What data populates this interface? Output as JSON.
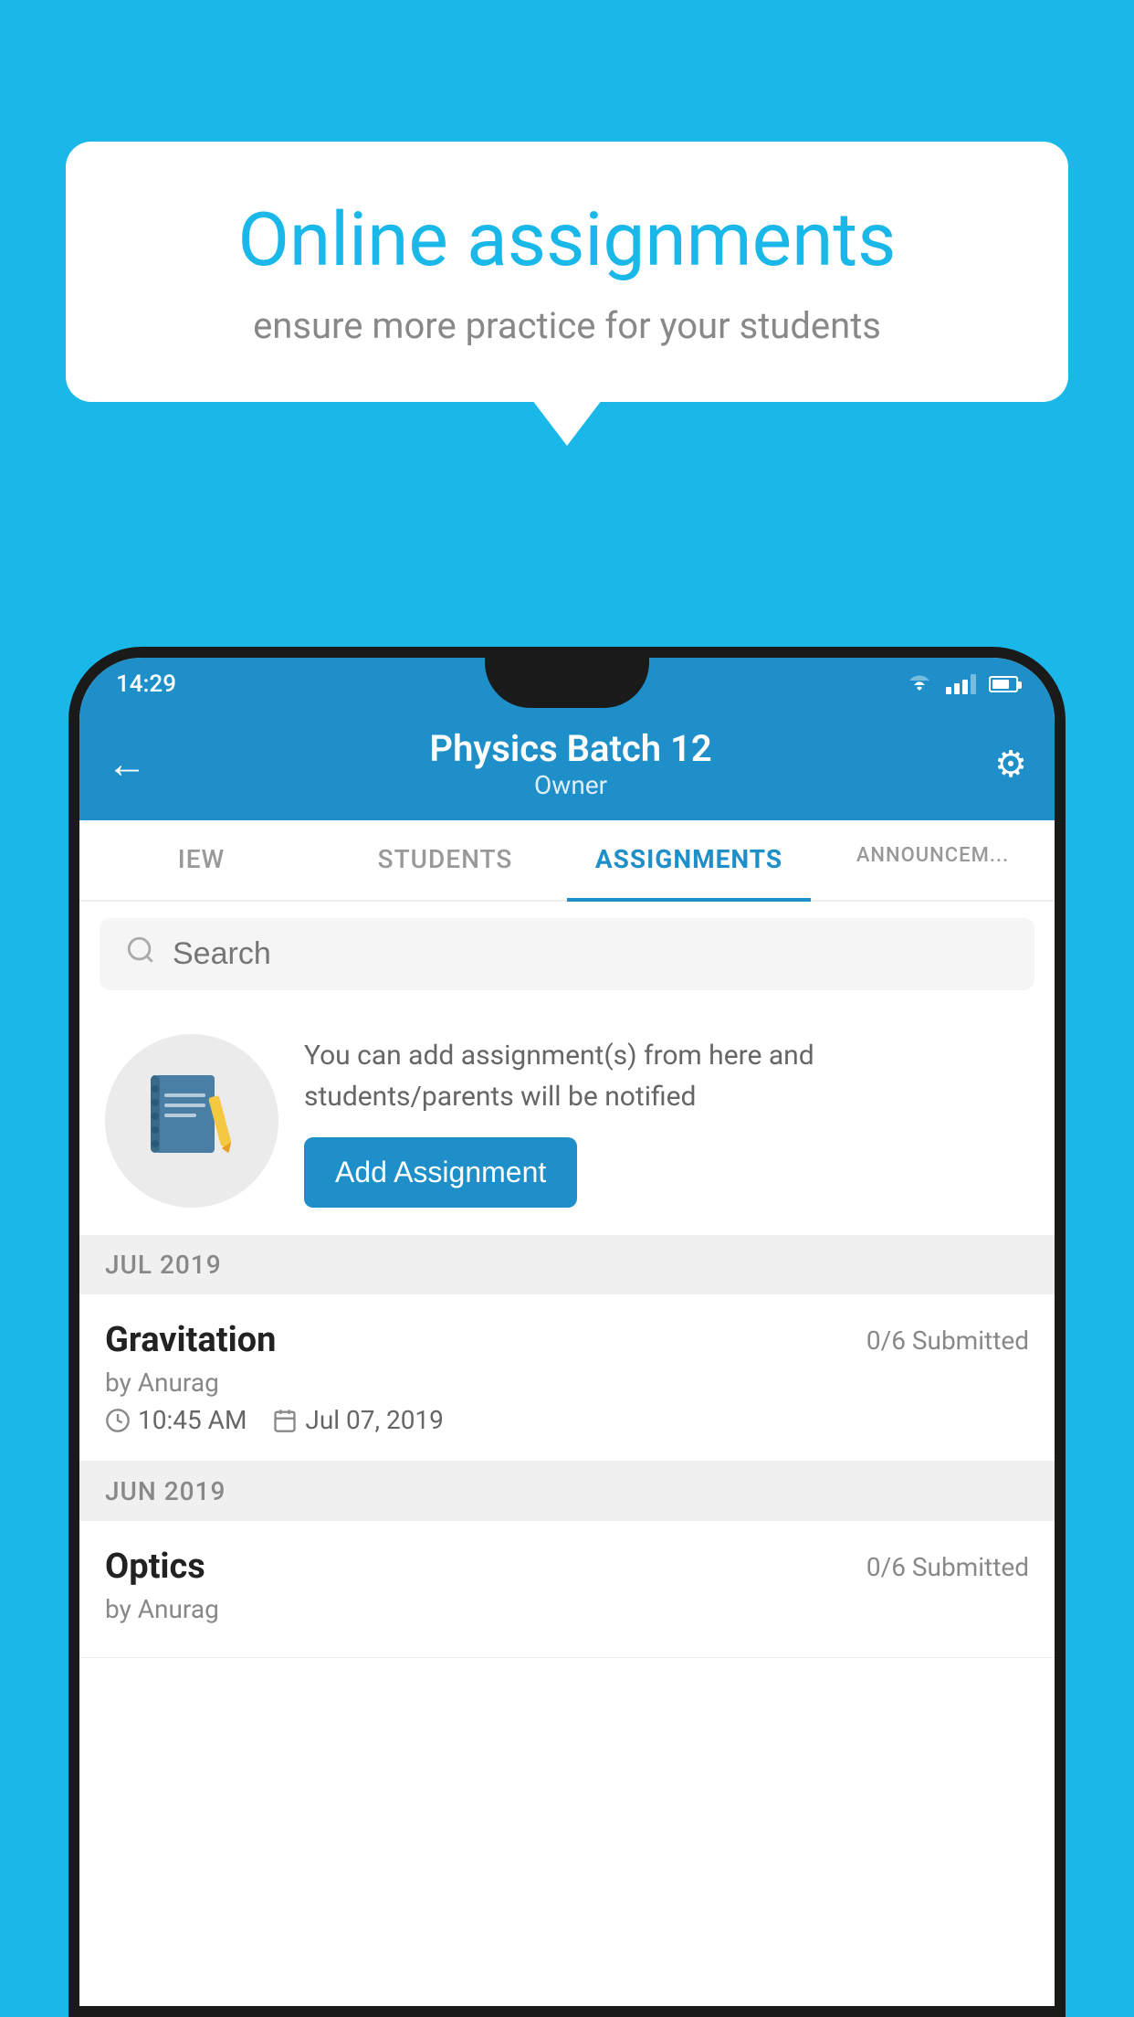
{
  "background_color": "#1ab8e8",
  "speech_bubble": {
    "heading": "Online assignments",
    "subtext": "ensure more practice for your students"
  },
  "status_bar": {
    "time": "14:29",
    "icons": [
      "wifi",
      "signal",
      "battery"
    ]
  },
  "top_bar": {
    "title": "Physics Batch 12",
    "subtitle": "Owner",
    "back_label": "←",
    "settings_label": "⚙"
  },
  "tabs": [
    {
      "label": "IEW",
      "active": false
    },
    {
      "label": "STUDENTS",
      "active": false
    },
    {
      "label": "ASSIGNMENTS",
      "active": true
    },
    {
      "label": "ANNOUNCEM...",
      "active": false
    }
  ],
  "search": {
    "placeholder": "Search"
  },
  "promo": {
    "text": "You can add assignment(s) from here and students/parents will be notified",
    "button_label": "Add Assignment"
  },
  "sections": [
    {
      "month_label": "JUL 2019",
      "assignments": [
        {
          "name": "Gravitation",
          "submitted": "0/6 Submitted",
          "by": "by Anurag",
          "time": "10:45 AM",
          "date": "Jul 07, 2019"
        }
      ]
    },
    {
      "month_label": "JUN 2019",
      "assignments": [
        {
          "name": "Optics",
          "submitted": "0/6 Submitted",
          "by": "by Anurag",
          "time": "",
          "date": ""
        }
      ]
    }
  ]
}
